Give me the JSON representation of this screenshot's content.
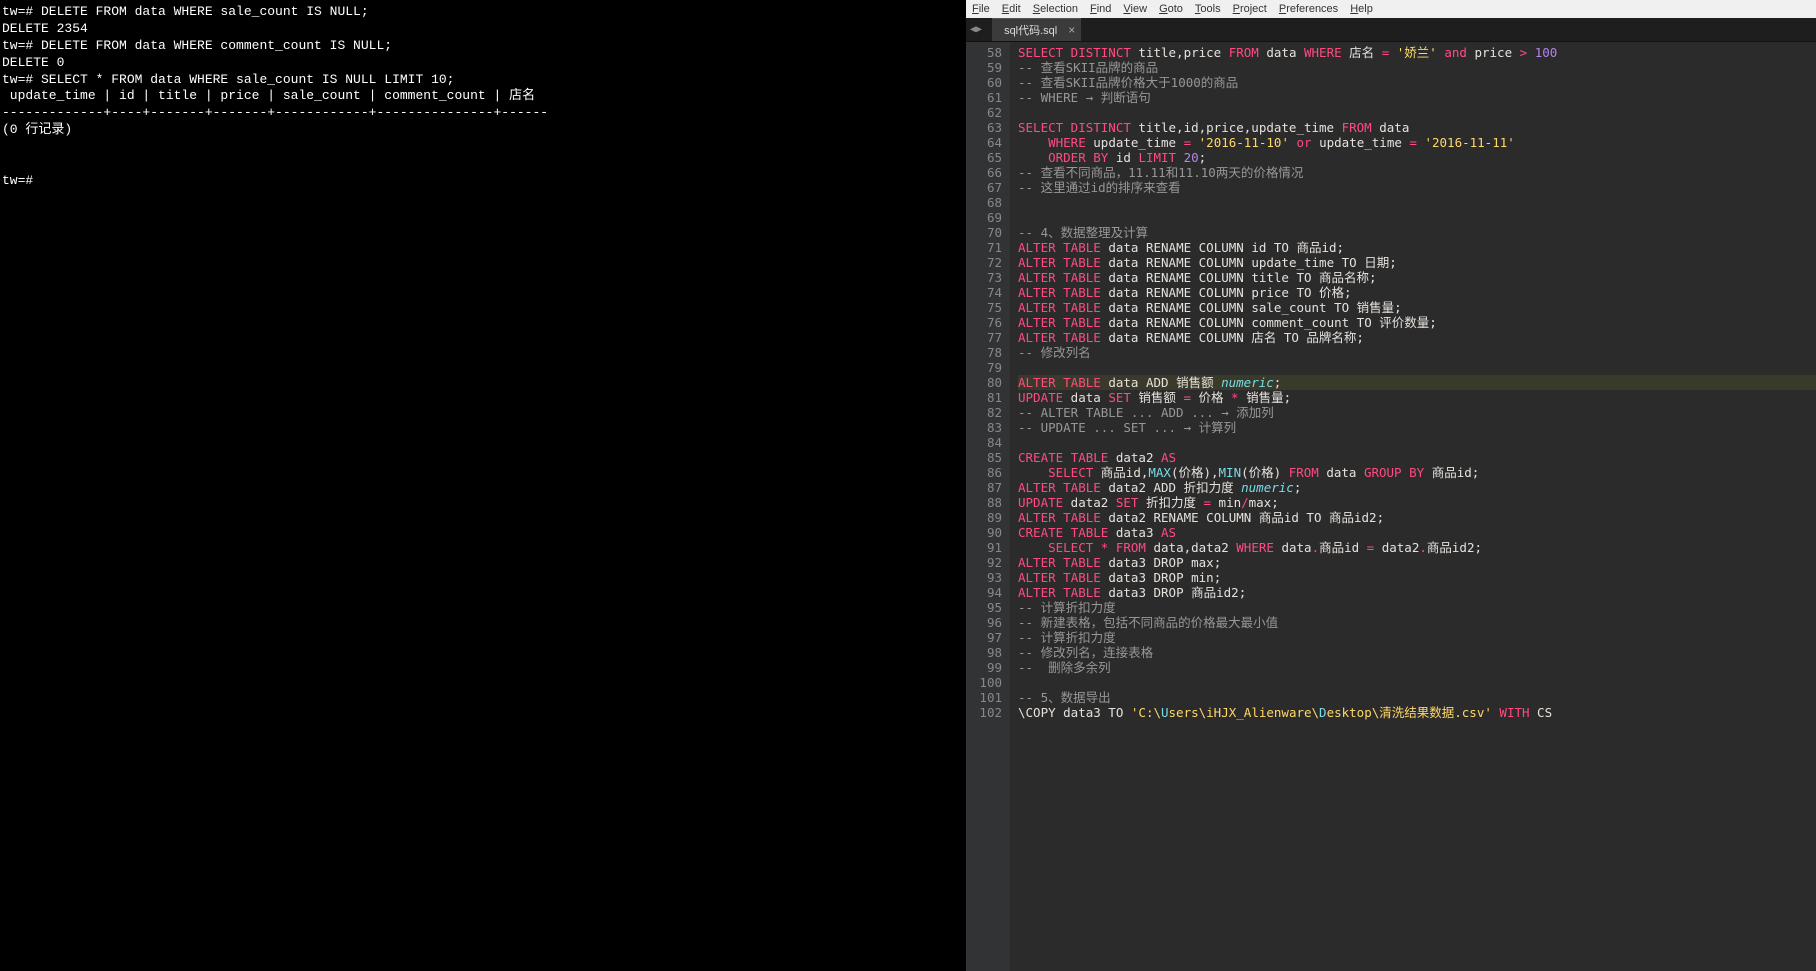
{
  "terminal": {
    "lines": [
      "tw=# DELETE FROM data WHERE sale_count IS NULL;",
      "DELETE 2354",
      "tw=# DELETE FROM data WHERE comment_count IS NULL;",
      "DELETE 0",
      "tw=# SELECT * FROM data WHERE sale_count IS NULL LIMIT 10;",
      " update_time | id | title | price | sale_count | comment_count | 店名",
      "-------------+----+-------+-------+------------+---------------+------",
      "(0 行记录)",
      "",
      "",
      "tw=#"
    ]
  },
  "editor": {
    "menu": [
      "File",
      "Edit",
      "Selection",
      "Find",
      "View",
      "Goto",
      "Tools",
      "Project",
      "Preferences",
      "Help"
    ],
    "tab_nav": {
      "left": "◀",
      "right": "▶"
    },
    "tab": {
      "label": "sql代码.sql",
      "close": "×"
    },
    "first_line": 58,
    "code_lines": [
      {
        "t": "code",
        "spans": [
          [
            "kw",
            "SELECT"
          ],
          [
            "",
            ""
          ],
          [
            "kw",
            " DISTINCT"
          ],
          [
            "",
            " title,price "
          ],
          [
            "kw",
            "FROM"
          ],
          [
            "",
            " data "
          ],
          [
            "kw",
            "WHERE"
          ],
          [
            "",
            " 店名 "
          ],
          [
            "kw",
            "="
          ],
          [
            "",
            " "
          ],
          [
            "str",
            "'娇兰'"
          ],
          [
            "",
            " "
          ],
          [
            "kw",
            "and"
          ],
          [
            "",
            " price "
          ],
          [
            "kw",
            ">"
          ],
          [
            "",
            " "
          ],
          [
            "num",
            "100"
          ]
        ]
      },
      {
        "t": "cm",
        "txt": "-- 查看SKII品牌的商品"
      },
      {
        "t": "cm",
        "txt": "-- 查看SKII品牌价格大于1000的商品"
      },
      {
        "t": "cm",
        "txt": "-- WHERE → 判断语句"
      },
      {
        "t": "blank"
      },
      {
        "t": "code",
        "spans": [
          [
            "kw",
            "SELECT"
          ],
          [
            "kw",
            " DISTINCT"
          ],
          [
            "",
            " title,id,price,update_time "
          ],
          [
            "kw",
            "FROM"
          ],
          [
            "",
            " data"
          ]
        ]
      },
      {
        "t": "code",
        "spans": [
          [
            "",
            "    "
          ],
          [
            "kw",
            "WHERE"
          ],
          [
            "",
            " update_time "
          ],
          [
            "kw",
            "="
          ],
          [
            "",
            " "
          ],
          [
            "str",
            "'2016-11-10'"
          ],
          [
            "",
            " "
          ],
          [
            "kw",
            "or"
          ],
          [
            "",
            " update_time "
          ],
          [
            "kw",
            "="
          ],
          [
            "",
            " "
          ],
          [
            "str",
            "'2016-11-11'"
          ]
        ]
      },
      {
        "t": "code",
        "spans": [
          [
            "",
            "    "
          ],
          [
            "kw",
            "ORDER BY"
          ],
          [
            "",
            " id "
          ],
          [
            "kw",
            "LIMIT"
          ],
          [
            "",
            " "
          ],
          [
            "num",
            "20"
          ],
          [
            "",
            ";"
          ]
        ]
      },
      {
        "t": "cm",
        "txt": "-- 查看不同商品，11.11和11.10两天的价格情况"
      },
      {
        "t": "cm",
        "txt": "-- 这里通过id的排序来查看"
      },
      {
        "t": "blank"
      },
      {
        "t": "blank"
      },
      {
        "t": "cm",
        "txt": "-- 4、数据整理及计算"
      },
      {
        "t": "code",
        "spans": [
          [
            "kw",
            "ALTER"
          ],
          [
            "",
            " "
          ],
          [
            "kw",
            "TABLE"
          ],
          [
            "",
            " data RENAME COLUMN id TO 商品id;"
          ]
        ]
      },
      {
        "t": "code",
        "spans": [
          [
            "kw",
            "ALTER"
          ],
          [
            "",
            " "
          ],
          [
            "kw",
            "TABLE"
          ],
          [
            "",
            " data RENAME COLUMN update_time TO 日期;"
          ]
        ]
      },
      {
        "t": "code",
        "spans": [
          [
            "kw",
            "ALTER"
          ],
          [
            "",
            " "
          ],
          [
            "kw",
            "TABLE"
          ],
          [
            "",
            " data RENAME COLUMN title TO 商品名称;"
          ]
        ]
      },
      {
        "t": "code",
        "spans": [
          [
            "kw",
            "ALTER"
          ],
          [
            "",
            " "
          ],
          [
            "kw",
            "TABLE"
          ],
          [
            "",
            " data RENAME COLUMN price TO 价格;"
          ]
        ]
      },
      {
        "t": "code",
        "spans": [
          [
            "kw",
            "ALTER"
          ],
          [
            "",
            " "
          ],
          [
            "kw",
            "TABLE"
          ],
          [
            "",
            " data RENAME COLUMN sale_count TO 销售量;"
          ]
        ]
      },
      {
        "t": "code",
        "spans": [
          [
            "kw",
            "ALTER"
          ],
          [
            "",
            " "
          ],
          [
            "kw",
            "TABLE"
          ],
          [
            "",
            " data RENAME COLUMN comment_count TO 评价数量;"
          ]
        ]
      },
      {
        "t": "code",
        "spans": [
          [
            "kw",
            "ALTER"
          ],
          [
            "",
            " "
          ],
          [
            "kw",
            "TABLE"
          ],
          [
            "",
            " data RENAME COLUMN 店名 TO 品牌名称;"
          ]
        ]
      },
      {
        "t": "cm",
        "txt": "-- 修改列名"
      },
      {
        "t": "blank"
      },
      {
        "t": "code",
        "hl": true,
        "spans": [
          [
            "kw",
            "ALTER"
          ],
          [
            "",
            " "
          ],
          [
            "kw",
            "TABLE"
          ],
          [
            "",
            " data ADD 销售额 "
          ],
          [
            "typ",
            "numeric"
          ],
          [
            "",
            ";"
          ]
        ]
      },
      {
        "t": "code",
        "spans": [
          [
            "kw",
            "UPDATE"
          ],
          [
            "",
            " data "
          ],
          [
            "kw",
            "SET"
          ],
          [
            "",
            " 销售额 "
          ],
          [
            "kw",
            "="
          ],
          [
            "",
            " 价格 "
          ],
          [
            "kw",
            "*"
          ],
          [
            "",
            " 销售量;"
          ]
        ]
      },
      {
        "t": "cm",
        "txt": "-- ALTER TABLE ... ADD ... → 添加列"
      },
      {
        "t": "cm",
        "txt": "-- UPDATE ... SET ... → 计算列"
      },
      {
        "t": "blank"
      },
      {
        "t": "code",
        "spans": [
          [
            "kw",
            "CREATE"
          ],
          [
            "",
            " "
          ],
          [
            "kw",
            "TABLE"
          ],
          [
            "",
            " data2 "
          ],
          [
            "kw",
            "AS"
          ]
        ]
      },
      {
        "t": "code",
        "spans": [
          [
            "",
            "    "
          ],
          [
            "kw",
            "SELECT"
          ],
          [
            "",
            " 商品id,"
          ],
          [
            "fn",
            "MAX"
          ],
          [
            "",
            "(价格),"
          ],
          [
            "fn",
            "MIN"
          ],
          [
            "",
            "(价格) "
          ],
          [
            "kw",
            "FROM"
          ],
          [
            "",
            " data "
          ],
          [
            "kw",
            "GROUP BY"
          ],
          [
            "",
            " 商品id;"
          ]
        ]
      },
      {
        "t": "code",
        "spans": [
          [
            "kw",
            "ALTER"
          ],
          [
            "",
            " "
          ],
          [
            "kw",
            "TABLE"
          ],
          [
            "",
            " data2 ADD 折扣力度 "
          ],
          [
            "typ",
            "numeric"
          ],
          [
            "",
            ";"
          ]
        ]
      },
      {
        "t": "code",
        "spans": [
          [
            "kw",
            "UPDATE"
          ],
          [
            "",
            " data2 "
          ],
          [
            "kw",
            "SET"
          ],
          [
            "",
            " 折扣力度 "
          ],
          [
            "kw",
            "="
          ],
          [
            "",
            " min"
          ],
          [
            "kw",
            "/"
          ],
          [
            "",
            "max;"
          ]
        ]
      },
      {
        "t": "code",
        "spans": [
          [
            "kw",
            "ALTER"
          ],
          [
            "",
            " "
          ],
          [
            "kw",
            "TABLE"
          ],
          [
            "",
            " data2 RENAME COLUMN 商品id TO 商品id2;"
          ]
        ]
      },
      {
        "t": "code",
        "spans": [
          [
            "kw",
            "CREATE"
          ],
          [
            "",
            " "
          ],
          [
            "kw",
            "TABLE"
          ],
          [
            "",
            " data3 "
          ],
          [
            "kw",
            "AS"
          ]
        ]
      },
      {
        "t": "code",
        "spans": [
          [
            "",
            "    "
          ],
          [
            "kw",
            "SELECT"
          ],
          [
            "",
            " "
          ],
          [
            "kw",
            "*"
          ],
          [
            "",
            " "
          ],
          [
            "kw",
            "FROM"
          ],
          [
            "",
            " data,data2 "
          ],
          [
            "kw",
            "WHERE"
          ],
          [
            "",
            " data"
          ],
          [
            "kw",
            "."
          ],
          [
            "",
            "商品id "
          ],
          [
            "kw",
            "="
          ],
          [
            "",
            " data2"
          ],
          [
            "kw",
            "."
          ],
          [
            "",
            "商品id2;"
          ]
        ]
      },
      {
        "t": "code",
        "spans": [
          [
            "kw",
            "ALTER"
          ],
          [
            "",
            " "
          ],
          [
            "kw",
            "TABLE"
          ],
          [
            "",
            " data3 DROP max;"
          ]
        ]
      },
      {
        "t": "code",
        "spans": [
          [
            "kw",
            "ALTER"
          ],
          [
            "",
            " "
          ],
          [
            "kw",
            "TABLE"
          ],
          [
            "",
            " data3 DROP min;"
          ]
        ]
      },
      {
        "t": "code",
        "spans": [
          [
            "kw",
            "ALTER"
          ],
          [
            "",
            " "
          ],
          [
            "kw",
            "TABLE"
          ],
          [
            "",
            " data3 DROP 商品id2;"
          ]
        ]
      },
      {
        "t": "cm",
        "txt": "-- 计算折扣力度"
      },
      {
        "t": "cm",
        "txt": "-- 新建表格，包括不同商品的价格最大最小值"
      },
      {
        "t": "cm",
        "txt": "-- 计算折扣力度"
      },
      {
        "t": "cm",
        "txt": "-- 修改列名，连接表格"
      },
      {
        "t": "cm",
        "txt": "--  删除多余列"
      },
      {
        "t": "blank"
      },
      {
        "t": "cm",
        "txt": "-- 5、数据导出"
      },
      {
        "t": "code",
        "spans": [
          [
            "",
            "\\COPY data3 TO "
          ],
          [
            "str",
            "'C:\\"
          ],
          [
            "fn",
            "U"
          ],
          [
            "str",
            "sers\\iHJX_Alienware\\"
          ],
          [
            "fn",
            "D"
          ],
          [
            "str",
            "esktop\\清洗结果数据.csv'"
          ],
          [
            "",
            " "
          ],
          [
            "kw",
            "WITH"
          ],
          [
            "",
            " CS"
          ]
        ]
      }
    ]
  }
}
